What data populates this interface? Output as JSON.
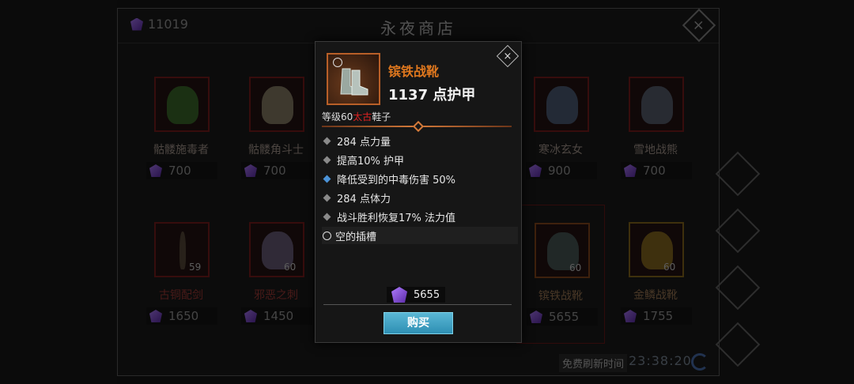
{
  "header": {
    "gem_count": "11019",
    "title": "永夜商店"
  },
  "cards_top": [
    {
      "name": "骷髅施毒者",
      "price": "700"
    },
    {
      "name": "骷髅角斗士",
      "price": "700"
    },
    {
      "name": "寒冰玄女",
      "price": "900"
    },
    {
      "name": "雪地战熊",
      "price": "700"
    }
  ],
  "cards_bottom": [
    {
      "name": "古铜配剑",
      "price": "1650",
      "level": "59"
    },
    {
      "name": "邪恶之刺",
      "price": "1450",
      "level": "60"
    },
    {
      "name": "镔铁战靴",
      "price": "5655",
      "level": "60"
    },
    {
      "name": "金鳞战靴",
      "price": "1755",
      "level": "60"
    }
  ],
  "footer": {
    "refresh_label": "免费刷新时间",
    "timer": "23:38:20"
  },
  "tooltip": {
    "item_name": "镔铁战靴",
    "armor": "1137 点护甲",
    "level_text": "等级60",
    "rarity": "太古",
    "slot_type": "鞋子",
    "stats": [
      "284 点力量",
      "提高10% 护甲",
      "降低受到的中毒伤害 50%",
      "284 点体力",
      "战斗胜利恢复17% 法力值"
    ],
    "socket": "空的插槽",
    "price": "5655",
    "buy_label": "购买",
    "close_symbol": "×"
  },
  "colors": {
    "item_name": "#e0781e",
    "rarity": "#dd2222",
    "buy_button": "#3a9ec4",
    "gem": "#8a4fe0"
  }
}
